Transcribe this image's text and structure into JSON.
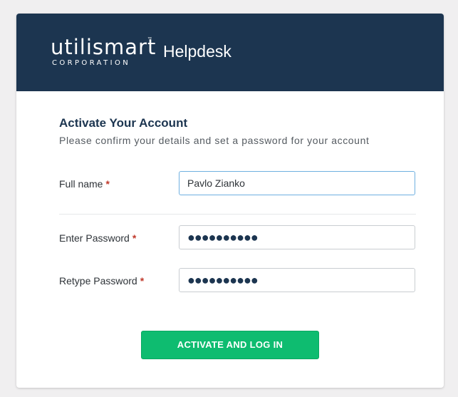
{
  "header": {
    "logo_word": "utilismart",
    "logo_tm": "™",
    "logo_corp": "CORPORATION",
    "app_title": "Helpdesk"
  },
  "form": {
    "title": "Activate Your Account",
    "subtitle": "Please confirm your details and set a password for your account",
    "required_mark": "*",
    "full_name": {
      "label": "Full name",
      "value": "Pavlo Zianko"
    },
    "password": {
      "label": "Enter Password",
      "value": "●●●●●●●●●●"
    },
    "retype_password": {
      "label": "Retype Password",
      "value": "●●●●●●●●●●"
    },
    "submit_label": "ACTIVATE AND LOG IN"
  },
  "colors": {
    "header_bg": "#1c3550",
    "accent_green": "#0ebc70",
    "required_red": "#c0392b",
    "focus_border": "#6fb0e0"
  }
}
